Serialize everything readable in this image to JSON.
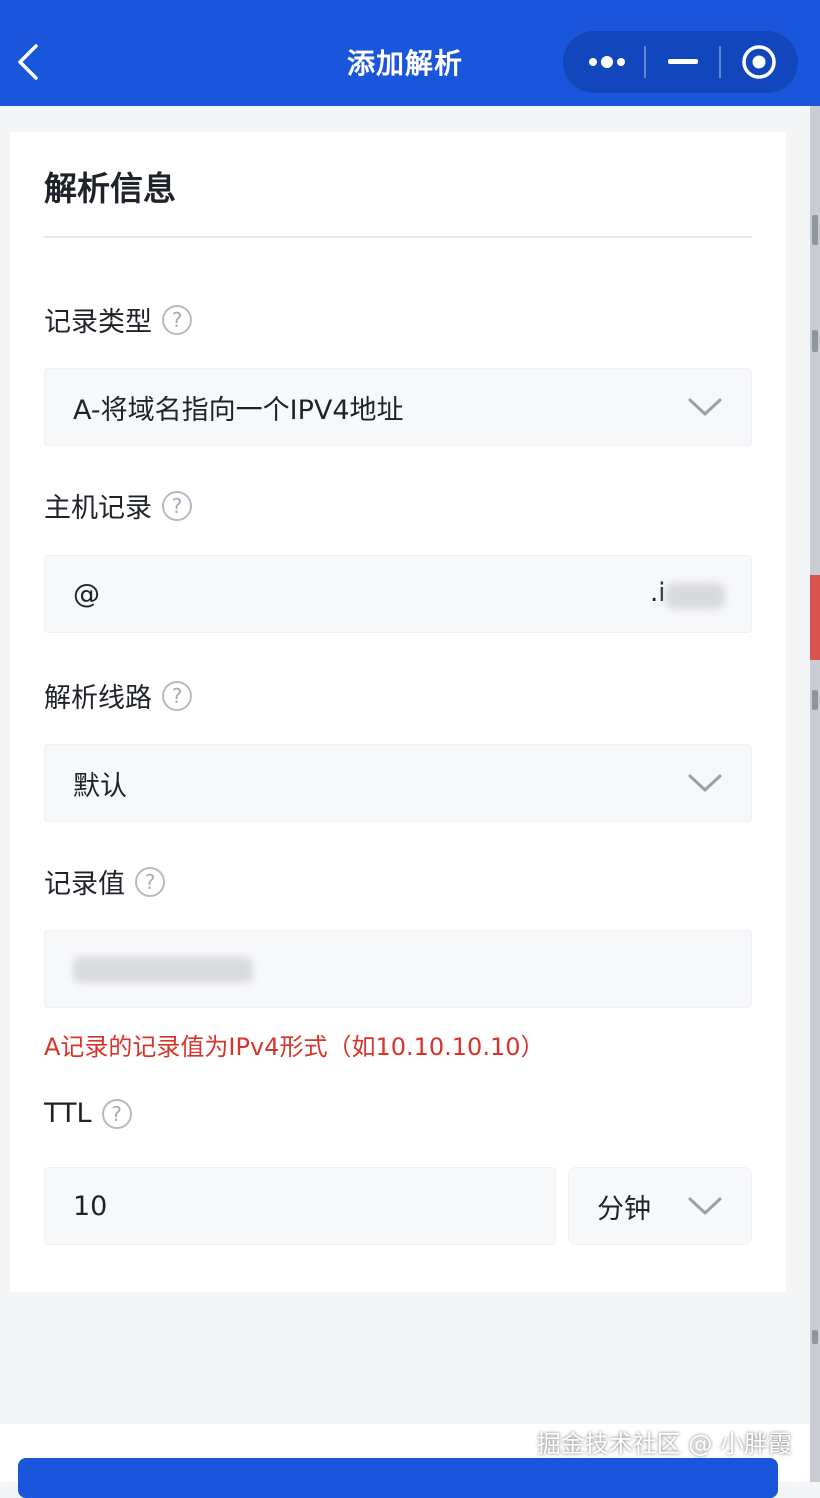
{
  "nav": {
    "title": "添加解析",
    "back_icon": "chevron-left-icon",
    "capsule": {
      "more_icon": "more-dots-icon",
      "minimize_icon": "minimize-icon",
      "close_icon": "target-circle-icon"
    }
  },
  "section": {
    "title": "解析信息"
  },
  "record_type": {
    "label": "记录类型",
    "value": "A-将域名指向一个IPV4地址"
  },
  "host_record": {
    "label": "主机记录",
    "value": "@",
    "suffix": ".i"
  },
  "line": {
    "label": "解析线路",
    "value": "默认"
  },
  "record_value": {
    "label": "记录值",
    "error": "A记录的记录值为IPv4形式（如10.10.10.10）"
  },
  "ttl": {
    "label": "TTL",
    "value": "10",
    "unit": "分钟"
  },
  "help_glyph": "?",
  "watermark": "掘金技术社区 @ 小胖霞",
  "colors": {
    "primary": "#1a56db",
    "error": "#d9342b",
    "field_bg": "#f7f8fa"
  }
}
